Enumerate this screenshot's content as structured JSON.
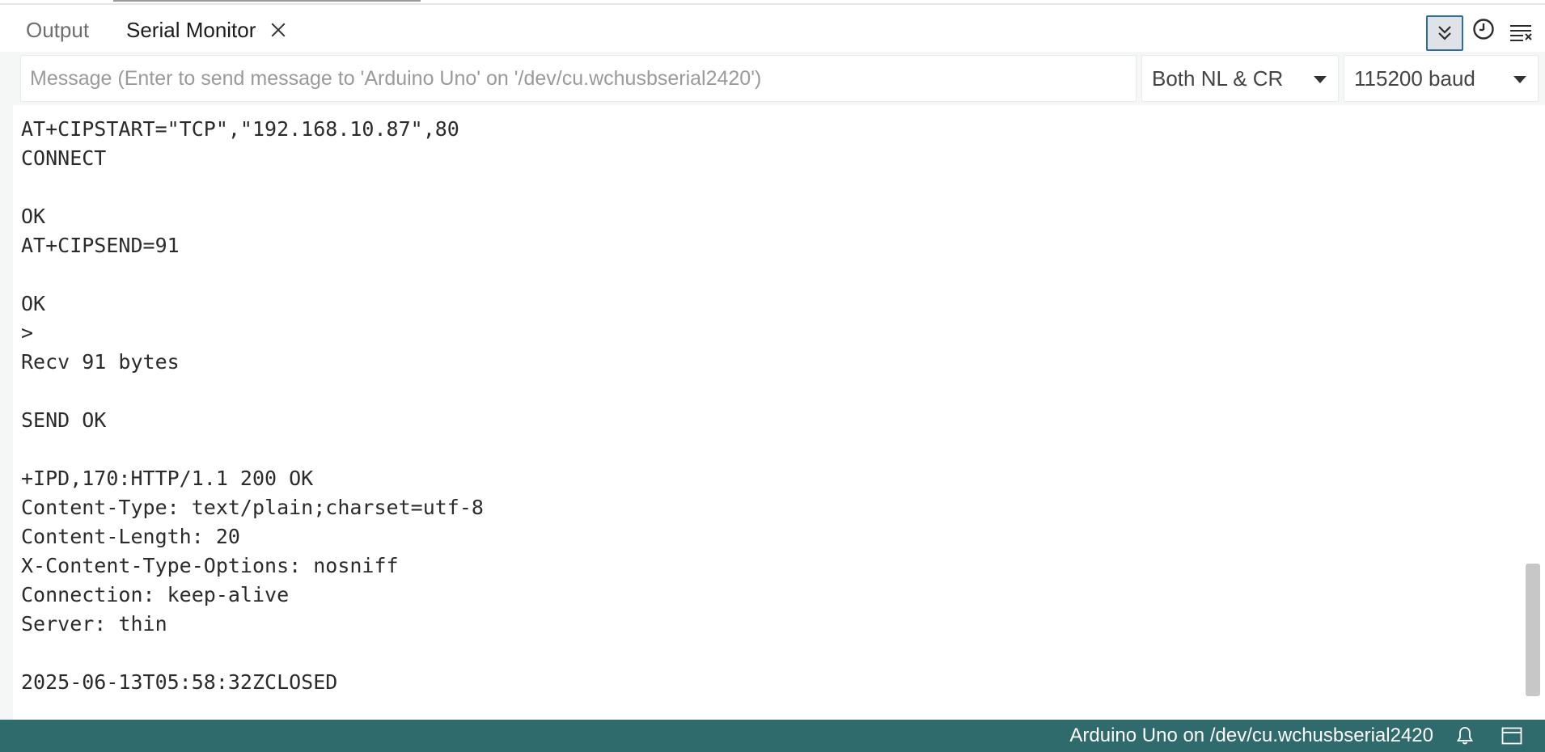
{
  "tabs": {
    "output_label": "Output",
    "serial_monitor_label": "Serial Monitor"
  },
  "toolbar": {
    "autoscroll_icon": "double-chevron-down-icon",
    "timestamp_icon": "clock-icon",
    "clear_icon": "clear-output-icon"
  },
  "message": {
    "placeholder": "Message (Enter to send message to 'Arduino Uno' on '/dev/cu.wchusbserial2420')",
    "value": ""
  },
  "line_ending": {
    "selected": "Both NL & CR"
  },
  "baud": {
    "selected": "115200 baud"
  },
  "console": {
    "lines": [
      "AT+CIPSTART=\"TCP\",\"192.168.10.87\",80",
      "CONNECT",
      "",
      "OK",
      "AT+CIPSEND=91",
      "",
      "OK",
      ">",
      "Recv 91 bytes",
      "",
      "SEND OK",
      "",
      "+IPD,170:HTTP/1.1 200 OK",
      "Content-Type: text/plain;charset=utf-8",
      "Content-Length: 20",
      "X-Content-Type-Options: nosniff",
      "Connection: keep-alive",
      "Server: thin",
      "",
      "2025-06-13T05:58:32ZCLOSED"
    ]
  },
  "statusbar": {
    "board_text": "Arduino Uno on /dev/cu.wchusbserial2420",
    "bell_icon": "bell-icon",
    "panel_icon": "toggle-panel-icon"
  },
  "colors": {
    "statusbar_bg": "#2f6a6c",
    "autoscroll_border": "#2e6f96"
  }
}
